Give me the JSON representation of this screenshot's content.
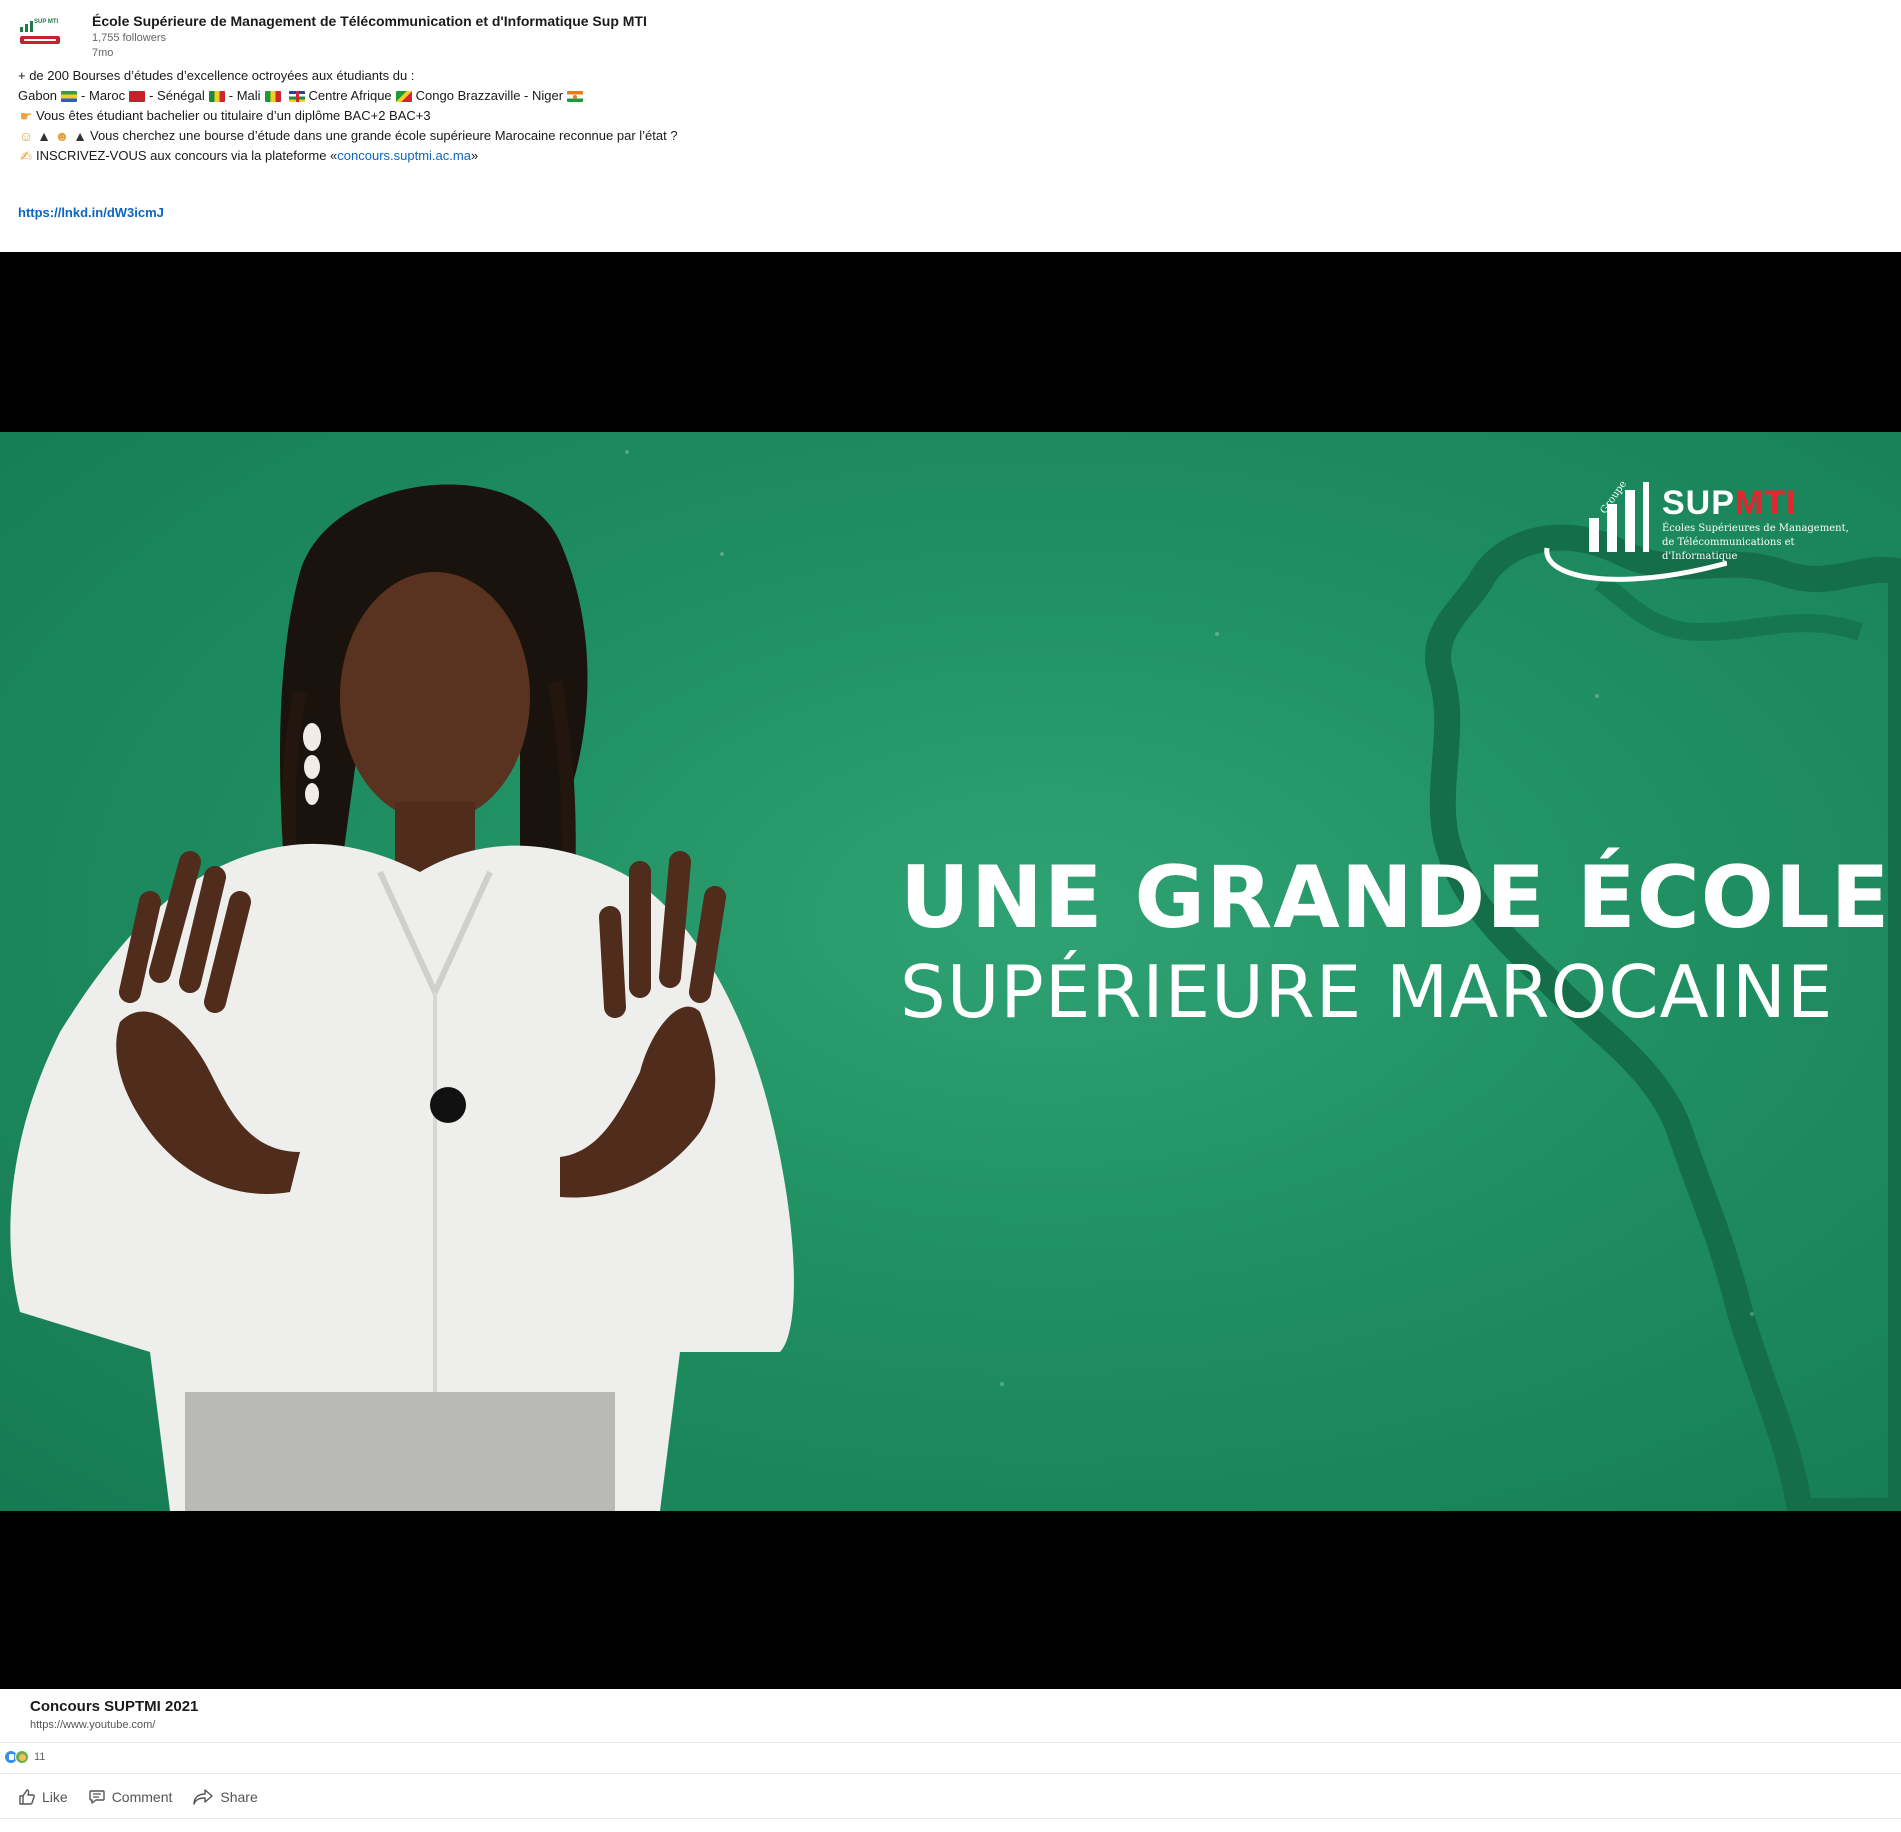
{
  "post": {
    "author_name": "École Supérieure de Management de Télécommunication et d'Informatique Sup MTI",
    "followers": "1,755 followers",
    "age": "7mo",
    "logo_text": "SUP MTI",
    "line1": "+ de 200 Bourses d’études d’excellence octroyées aux étudiants du :",
    "countries": {
      "gabon": "Gabon",
      "sep1": " - Maroc",
      "sep2": " - Sénégal",
      "sep3": " - Mali",
      "car": "Centre Afrique",
      "congo": "Congo Brazzaville - Niger"
    },
    "line3": "Vous êtes étudiant bachelier ou titulaire d’un diplôme BAC+2 BAC+3",
    "line4": "Vous cherchez une bourse d’étude dans une grande école supérieure Marocaine reconnue par l’état ?",
    "line5_prefix": "INSCRIVEZ-VOUS  aux concours via la plateforme « ",
    "line5_link": "concours.suptmi.ac.ma",
    "line5_suffix": " »",
    "short_link": "https://lnkd.in/dW3icmJ"
  },
  "video": {
    "brand_sup": "SUP",
    "brand_mti": "MTI",
    "brand_groupe": "Groupe",
    "brand_sub": "Écoles Supérieures de Management, de Télécommunications et d'Informatique",
    "headline_1": "UNE GRANDE ÉCOLE",
    "headline_2": "SUPÉRIEURE MAROCAINE"
  },
  "preview": {
    "title": "Concours SUPTMI 2021",
    "url": "https://www.youtube.com/"
  },
  "social": {
    "reaction_count": "11",
    "reaction_icons": [
      "like-icon",
      "support-icon"
    ]
  },
  "actions": {
    "like": "Like",
    "comment": "Comment",
    "share": "Share"
  },
  "colors": {
    "link": "#0a66c2",
    "video_green": "#1f8f62",
    "brand_red": "#e3262d"
  }
}
